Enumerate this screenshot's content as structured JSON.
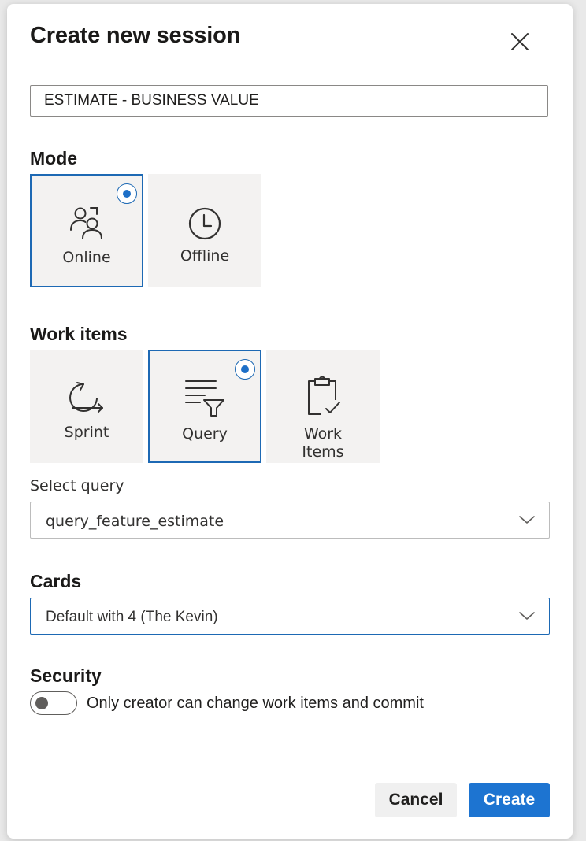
{
  "dialog": {
    "title": "Create new session",
    "session_name_value": "ESTIMATE - BUSINESS VALUE"
  },
  "mode": {
    "label": "Mode",
    "options": [
      {
        "label": "Online",
        "icon": "people-icon",
        "selected": true
      },
      {
        "label": "Offline",
        "icon": "clock-icon",
        "selected": false
      }
    ]
  },
  "work_items": {
    "label": "Work items",
    "options": [
      {
        "label": "Sprint",
        "icon": "sprint-cycle-icon",
        "selected": false
      },
      {
        "label": "Query",
        "icon": "query-filter-icon",
        "selected": true
      },
      {
        "label_line1": "Work",
        "label_line2": "Items",
        "icon": "clipboard-check-icon",
        "selected": false
      }
    ]
  },
  "select_query": {
    "label": "Select query",
    "value": "query_feature_estimate"
  },
  "cards": {
    "label": "Cards",
    "value": "Default with 4 (The Kevin)"
  },
  "security": {
    "label": "Security",
    "toggle_label": "Only creator can change work items and commit",
    "enabled": false
  },
  "actions": {
    "cancel_label": "Cancel",
    "create_label": "Create"
  },
  "colors": {
    "accent": "#1d74d1",
    "selected_border": "#1d69b4",
    "tile_background": "#f3f2f1"
  }
}
